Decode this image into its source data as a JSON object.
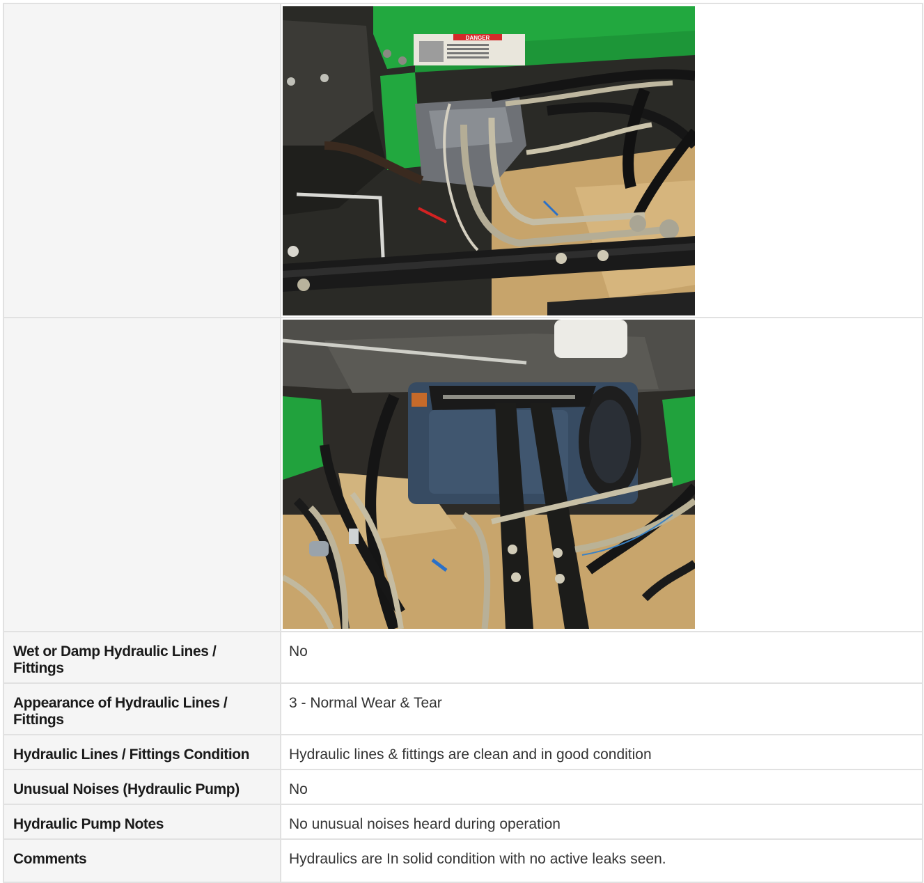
{
  "rows": [
    {
      "label": "Wet or Damp Hydraulic Lines / Fittings",
      "value": "No"
    },
    {
      "label": "Appearance of Hydraulic Lines / Fittings",
      "value": "3 - Normal Wear & Tear"
    },
    {
      "label": "Hydraulic Lines / Fittings Condition",
      "value": "Hydraulic lines & fittings are clean and in good condition"
    },
    {
      "label": "Unusual Noises (Hydraulic Pump)",
      "value": "No"
    },
    {
      "label": "Hydraulic Pump Notes",
      "value": "No unusual noises heard during operation"
    },
    {
      "label": "Comments",
      "value": "Hydraulics are In solid condition with no active leaks seen."
    }
  ],
  "photos": {
    "photo1": {
      "danger_label": "DANGER"
    }
  },
  "colors": {
    "border": "#e1e1e1",
    "label_bg": "#f5f5f5",
    "machine_green": "#1fa33a",
    "floor_tan": "#c9a873",
    "pump_blue": "#33465c"
  }
}
